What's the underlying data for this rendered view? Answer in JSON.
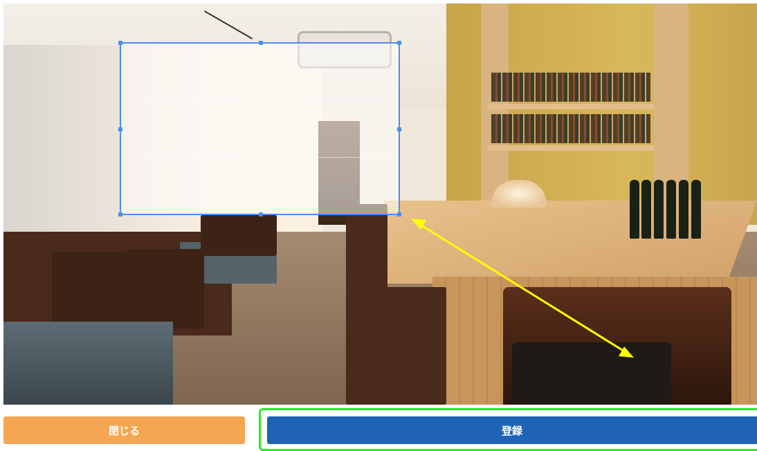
{
  "buttons": {
    "close_label": "閉じる",
    "register_label": "登録"
  },
  "colors": {
    "close_button": "#f4a653",
    "register_button": "#1e63b6",
    "focus_outline": "#2ee62e",
    "selection_border": "#4a8ee8",
    "annotation_arrow": "#ffff00"
  },
  "icons": {
    "annotation": "double-headed-arrow"
  }
}
